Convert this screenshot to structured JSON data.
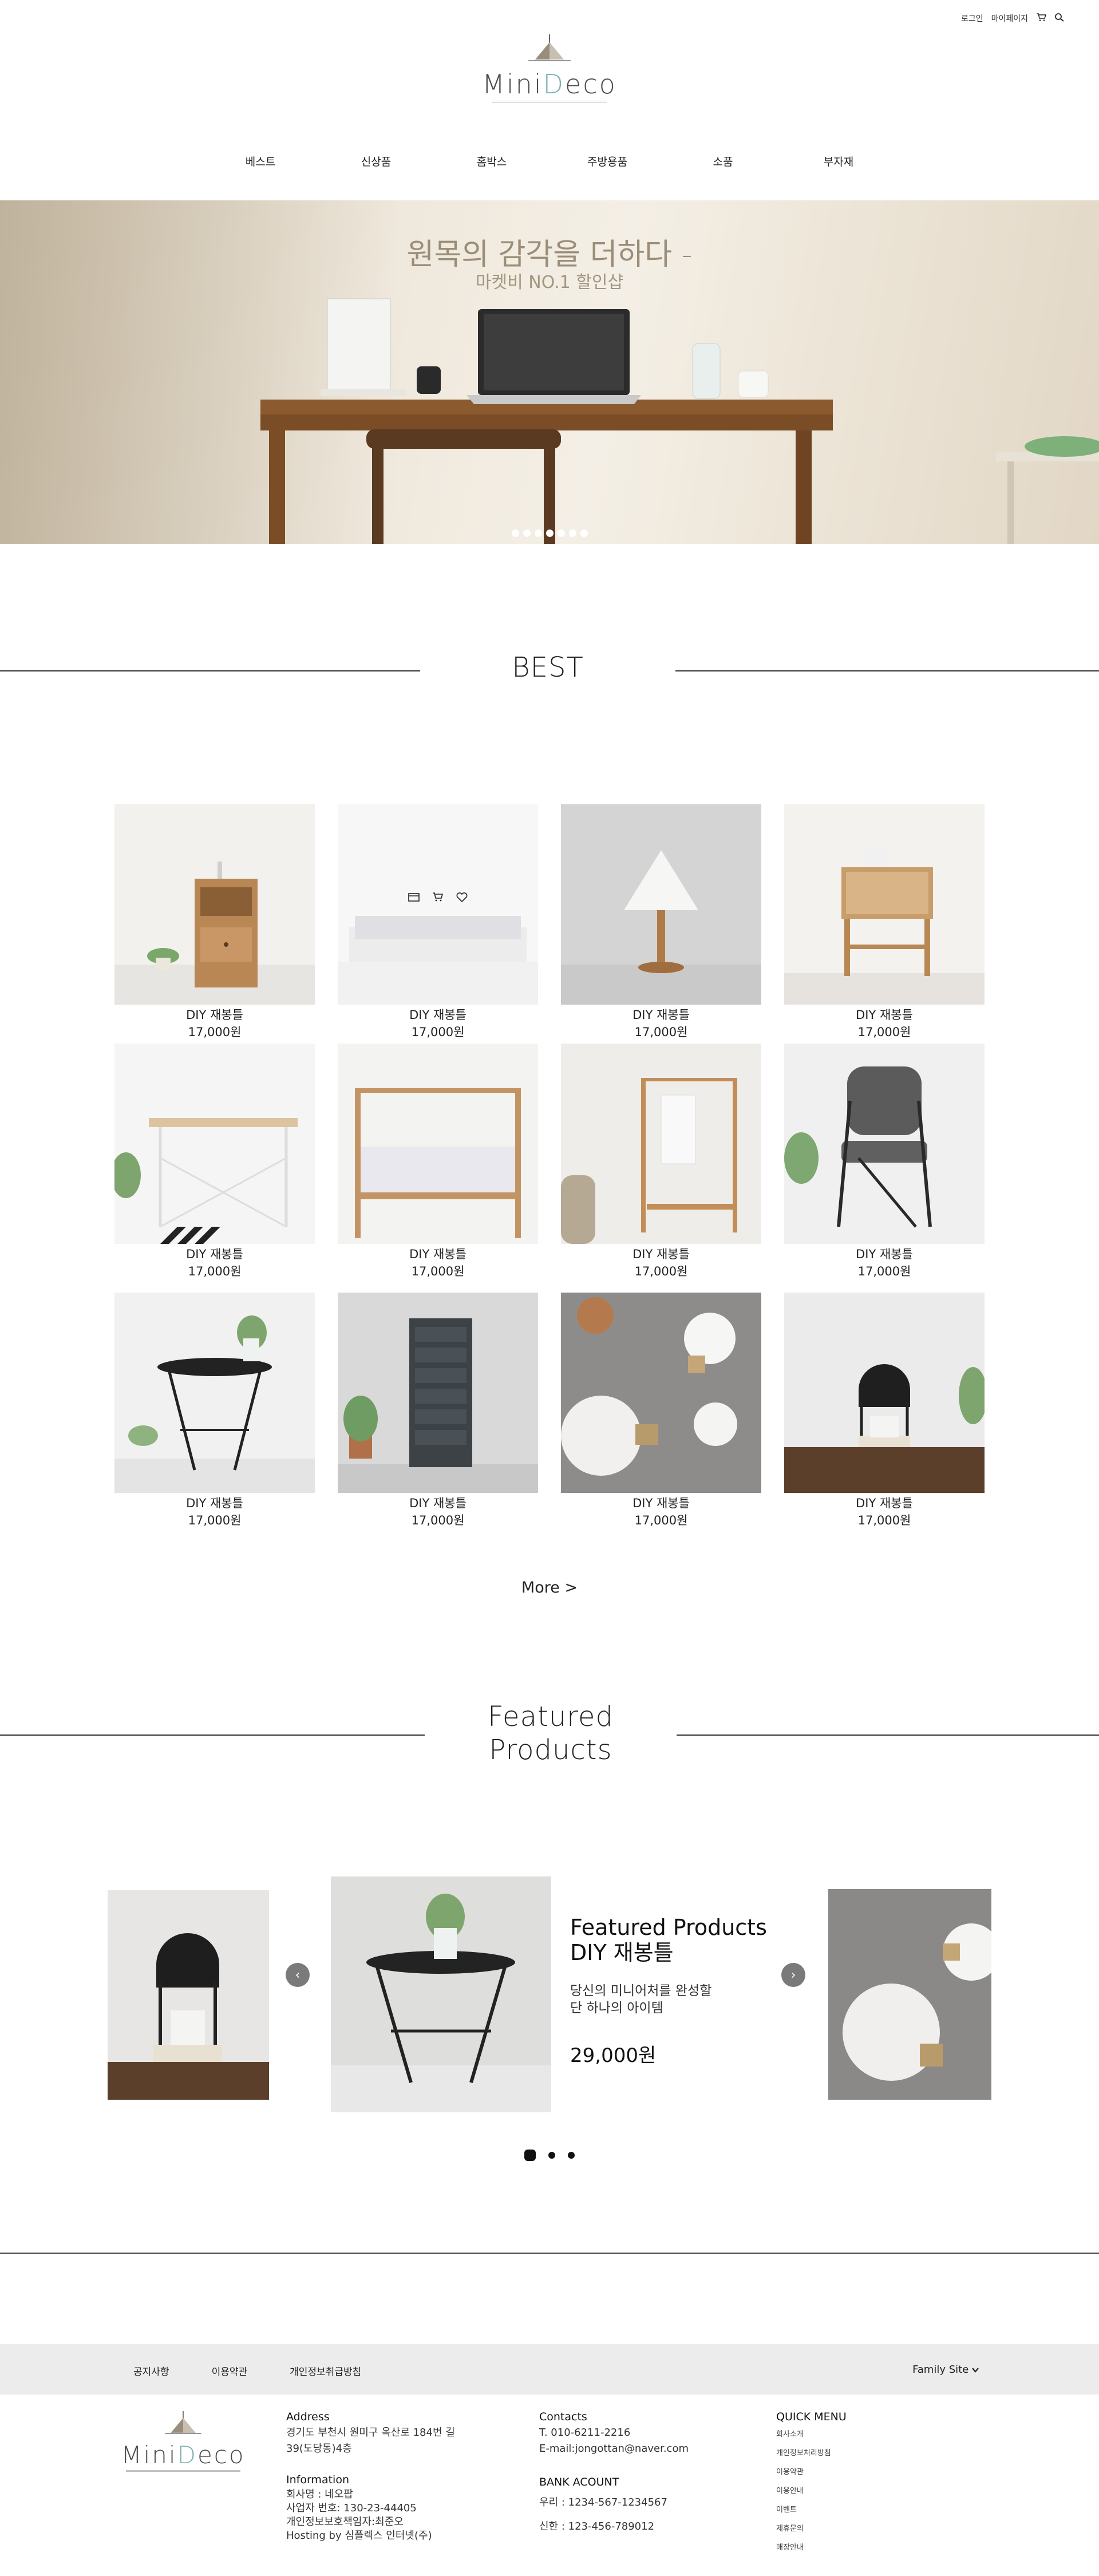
{
  "header": {
    "util": {
      "login": "로그인",
      "mypage": "마이페이지"
    },
    "logo": {
      "text_a": "M",
      "text_b": "ini",
      "text_c": "D",
      "text_d": "eco"
    },
    "nav": [
      "베스트",
      "신상품",
      "홈박스",
      "주방용품",
      "소품",
      "부자재"
    ]
  },
  "hero": {
    "title": "원목의 감각을 더하다 -",
    "subtitle": "마켓비 NO.1 할인샵",
    "dots": 7
  },
  "best": {
    "title": "BEST",
    "products": [
      {
        "name": "DIY 재봉틀",
        "price": "17,000원"
      },
      {
        "name": "DIY 재봉틀",
        "price": "17,000원"
      },
      {
        "name": "DIY 재봉틀",
        "price": "17,000원"
      },
      {
        "name": "DIY 재봉틀",
        "price": "17,000원"
      },
      {
        "name": "DIY 재봉틀",
        "price": "17,000원"
      },
      {
        "name": "DIY 재봉틀",
        "price": "17,000원"
      },
      {
        "name": "DIY 재봉틀",
        "price": "17,000원"
      },
      {
        "name": "DIY 재봉틀",
        "price": "17,000원"
      },
      {
        "name": "DIY 재봉틀",
        "price": "17,000원"
      },
      {
        "name": "DIY 재봉틀",
        "price": "17,000원"
      },
      {
        "name": "DIY 재봉틀",
        "price": "17,000원"
      },
      {
        "name": "DIY 재봉틀",
        "price": "17,000원"
      }
    ],
    "more": "More >"
  },
  "featured": {
    "title_line1": "Featured",
    "title_line2": "Products",
    "card": {
      "title_line1": "Featured Products",
      "title_line2": "DIY 재봉틀",
      "desc_line1": "당신의 미니어처를 완성할",
      "desc_line2": "단 하나의 아이템",
      "price": "29,000원"
    },
    "prev": "‹",
    "next": "›"
  },
  "footer": {
    "links": [
      "공지사항",
      "이용약관",
      "개인정보취급방침"
    ],
    "family": "Family Site",
    "address": {
      "heading": "Address",
      "line1": "경기도 부천시 원미구 옥산로 184번 길",
      "line2": "39(도당동)4층"
    },
    "information": {
      "heading": "Information",
      "line1": "회사명 : 네오팝",
      "line2": "사업자 번호: 130-23-44405",
      "line3": "개인정보보호책임자:최준오",
      "line4": "Hosting by 심플렉스 인터넷(주)"
    },
    "contacts": {
      "heading": "Contacts",
      "phone": "T. 010-6211-2216",
      "email": "E-mail:jongottan@naver.com"
    },
    "bank": {
      "heading": "BANK ACOUNT",
      "line1": "우리 : 1234-567-1234567",
      "line2": "신한 : 123-456-789012"
    },
    "quick_menu": {
      "heading": "QUICK MENU",
      "items": [
        "회사소개",
        "개인정보처리방침",
        "이용약관",
        "이용안내",
        "이벤트",
        "제휴문의",
        "매장안내"
      ]
    }
  }
}
